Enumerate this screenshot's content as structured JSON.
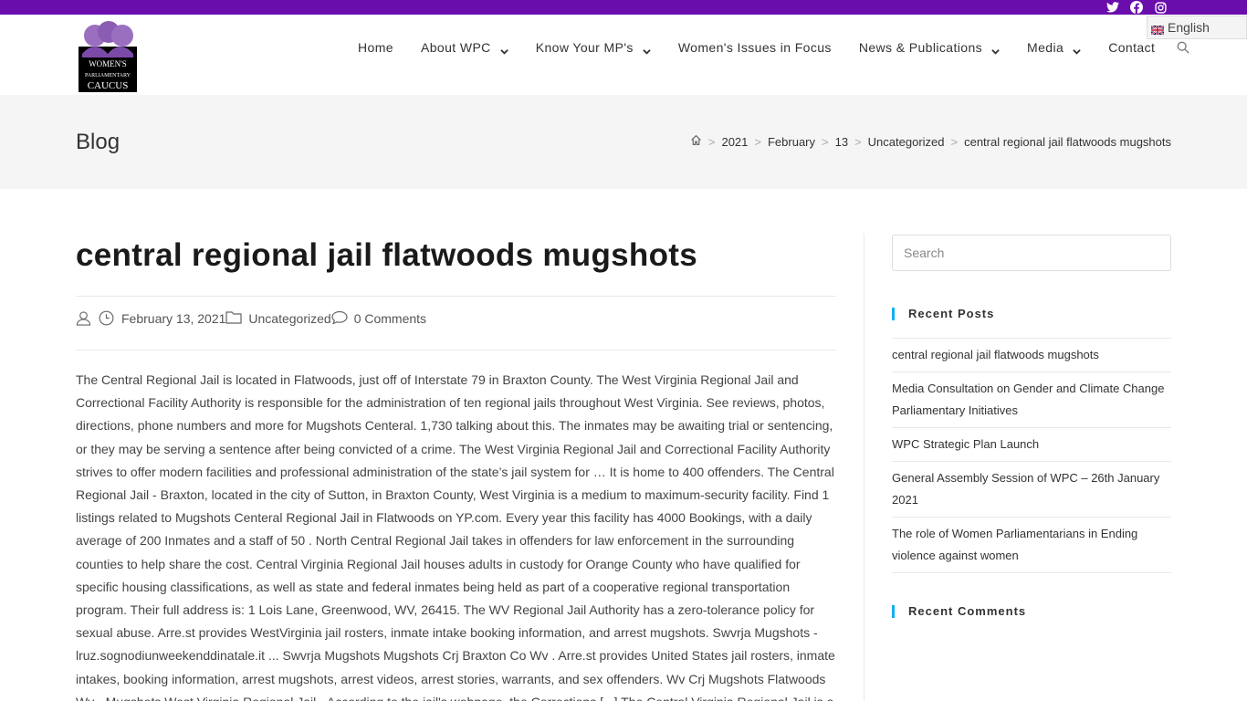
{
  "topbar": {
    "social": [
      "twitter-icon",
      "facebook-icon",
      "instagram-icon"
    ],
    "bg_color": "#6a0dad"
  },
  "language": {
    "label": "English"
  },
  "header": {
    "logo_alt": "Women's Parliamentary Caucus",
    "logo_lines": [
      "WOMEN'S",
      "PARLIAMENTARY",
      "CAUCUS"
    ],
    "nav": [
      {
        "label": "Home",
        "dropdown": false
      },
      {
        "label": "About WPC",
        "dropdown": true
      },
      {
        "label": "Know Your MP's",
        "dropdown": true
      },
      {
        "label": "Women's Issues in Focus",
        "dropdown": false
      },
      {
        "label": "News & Publications",
        "dropdown": true
      },
      {
        "label": "Media",
        "dropdown": true
      },
      {
        "label": "Contact",
        "dropdown": false
      }
    ]
  },
  "titlebar": {
    "title": "Blog",
    "breadcrumb": [
      "2021",
      "February",
      "13",
      "Uncategorized",
      "central regional jail flatwoods mugshots"
    ]
  },
  "post": {
    "title": "central regional jail flatwoods mugshots",
    "date": "February 13, 2021",
    "category": "Uncategorized",
    "comments": "0 Comments",
    "body": "The Central Regional Jail is located in Flatwoods, just off of Interstate 79 in Braxton County. The West Virginia Regional Jail and Correctional Facility Authority is responsible for the administration of ten regional jails throughout West Virginia. See reviews, photos, directions, phone numbers and more for Mugshots Centeral. 1,730 talking about this. The inmates may be awaiting trial or sentencing, or they may be serving a sentence after being convicted of a crime. The West Virginia Regional Jail and Correctional Facility Authority strives to offer modern facilities and professional administration of the state’s jail system for … It is home to 400 offenders. The Central Regional Jail - Braxton, located in the city of Sutton, in Braxton County, West Virginia is a medium to maximum-security facility. Find 1 listings related to Mugshots Centeral Regional Jail in Flatwoods on YP.com. Every year this facility has 4000 Bookings, with a daily average of 200 Inmates and a staff of 50 . North Central Regional Jail takes in offenders for law enforcement in the surrounding counties to help share the cost. Central Virginia Regional Jail houses adults in custody for Orange County who have qualified for specific housing classifications, as well as state and federal inmates being held as part of a cooperative regional transportation program. Their full address is: 1 Lois Lane, Greenwood, WV, 26415. The WV Regional Jail Authority has a zero-tolerance policy for sexual abuse. Arre.st provides WestVirginia jail rosters, inmate intake booking information, and arrest mugshots. Swvrja Mugshots - lruz.sognodiunweekenddinatale.it ... Swvrja Mugshots Mugshots Crj Braxton Co Wv . Arre.st provides United States jail rosters, inmate intakes, booking information, arrest mugshots, arrest videos, arrest stories, warrants, and sex offenders. Wv Crj Mugshots Flatwoods Wv - Mugshots West Virginia Regional Jail - According to the jail's webpage, the Corrections [...] The Central Virginia Regional Jail is a"
  },
  "sidebar": {
    "search_placeholder": "Search",
    "recent_posts_title": "Recent Posts",
    "recent_posts": [
      "central regional jail flatwoods mugshots",
      "Media Consultation on Gender and Climate Change Parliamentary Initiatives",
      "WPC Strategic Plan Launch",
      "General Assembly Session of WPC – 26th January 2021",
      "The role of Women Parliamentarians in Ending violence against women"
    ],
    "recent_comments_title": "Recent Comments"
  },
  "colors": {
    "accent": "#13aff0",
    "purple": "#6a0dad"
  }
}
